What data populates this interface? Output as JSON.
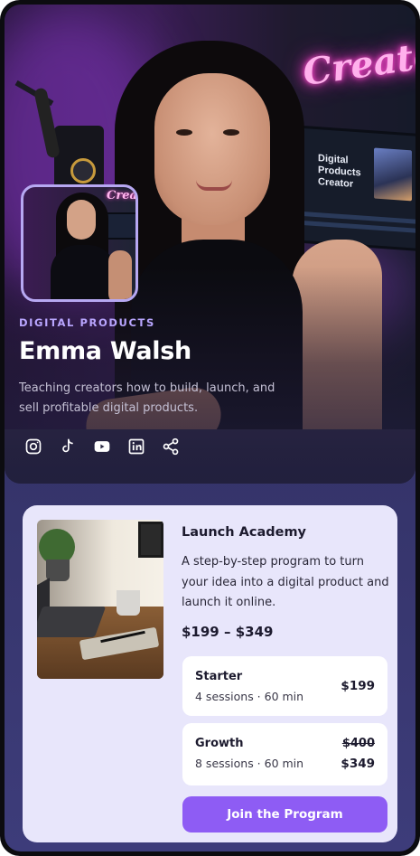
{
  "hero": {
    "background_neon_text": "Create",
    "monitor_text": "Digital\nProducts\nCreator",
    "avatar_neon_text": "Create"
  },
  "profile": {
    "category": "DIGITAL PRODUCTS",
    "name": "Emma Walsh",
    "tagline": "Teaching creators how to build, launch, and sell profitable digital products.",
    "socials": [
      {
        "icon": "instagram-icon"
      },
      {
        "icon": "tiktok-icon"
      },
      {
        "icon": "youtube-icon"
      },
      {
        "icon": "linkedin-icon"
      },
      {
        "icon": "share-icon"
      }
    ]
  },
  "course": {
    "title": "Launch Academy",
    "description": "A step-by-step program to turn your idea into a digital product and launch it online.",
    "price_range": "$199 – $349",
    "tiers": [
      {
        "name": "Starter",
        "meta": "4 sessions · 60 min",
        "price": "$199"
      },
      {
        "name": "Growth",
        "meta": "8 sessions · 60 min",
        "old_price": "$400",
        "price": "$349"
      }
    ],
    "cta_label": "Join the Program"
  },
  "colors": {
    "accent": "#8e5cf4",
    "category_text": "#b9a6ff",
    "card_background": "#e8e6fb"
  }
}
